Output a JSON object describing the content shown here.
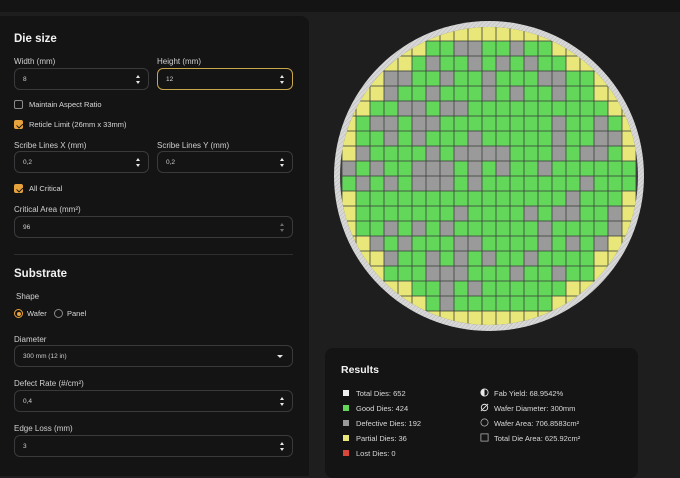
{
  "die_size": {
    "heading": "Die size",
    "width": {
      "label": "Width (mm)",
      "value": "8"
    },
    "height": {
      "label": "Height (mm)",
      "value": "12"
    },
    "maintain_aspect": {
      "label": "Maintain Aspect Ratio",
      "checked": false
    },
    "reticle_limit": {
      "label": "Reticle Limit (26mm x 33mm)",
      "checked": true
    },
    "scribe_x": {
      "label": "Scribe Lines X (mm)",
      "value": "0,2"
    },
    "scribe_y": {
      "label": "Scribe Lines Y (mm)",
      "value": "0,2"
    },
    "all_critical": {
      "label": "All Critical",
      "checked": true
    },
    "critical_area": {
      "label": "Critical Area (mm²)",
      "value": "96"
    }
  },
  "substrate": {
    "heading": "Substrate",
    "shape_label": "Shape",
    "shape_options": [
      "Wafer",
      "Panel"
    ],
    "shape_selected": "Wafer",
    "diameter": {
      "label": "Diameter",
      "value": "300 mm (12 in)"
    },
    "defect_rate": {
      "label": "Defect Rate (#/cm²)",
      "value": "0,4"
    },
    "edge_loss": {
      "label": "Edge Loss (mm)",
      "value": "3"
    }
  },
  "results": {
    "title": "Results",
    "total_dies": "Total Dies: 652",
    "good_dies": "Good Dies: 424",
    "defective_dies": "Defective Dies: 192",
    "partial_dies": "Partial Dies: 36",
    "lost_dies": "Lost Dies: 0",
    "fab_yield": "Fab Yield: 68.9542%",
    "wafer_diameter": "Wafer Diameter: 300mm",
    "wafer_area": "Wafer Area: 706.8583cm²",
    "total_die_area": "Total Die Area: 625.92cm²"
  },
  "colors": {
    "good": "#62d75a",
    "defective": "#9a9a9a",
    "partial": "#e9e77a",
    "lost": "#d9473b",
    "total": "#f0f0f0",
    "accent": "#e8a33c"
  },
  "wafer": {
    "grid_cols": 21,
    "grid_rows": 20,
    "defect_fraction": 0.294,
    "icons": {
      "fab_yield": "half-circle-icon",
      "wafer_diameter": "diameter-icon",
      "wafer_area": "circle-outline-icon",
      "total_die_area": "square-outline-icon"
    }
  }
}
